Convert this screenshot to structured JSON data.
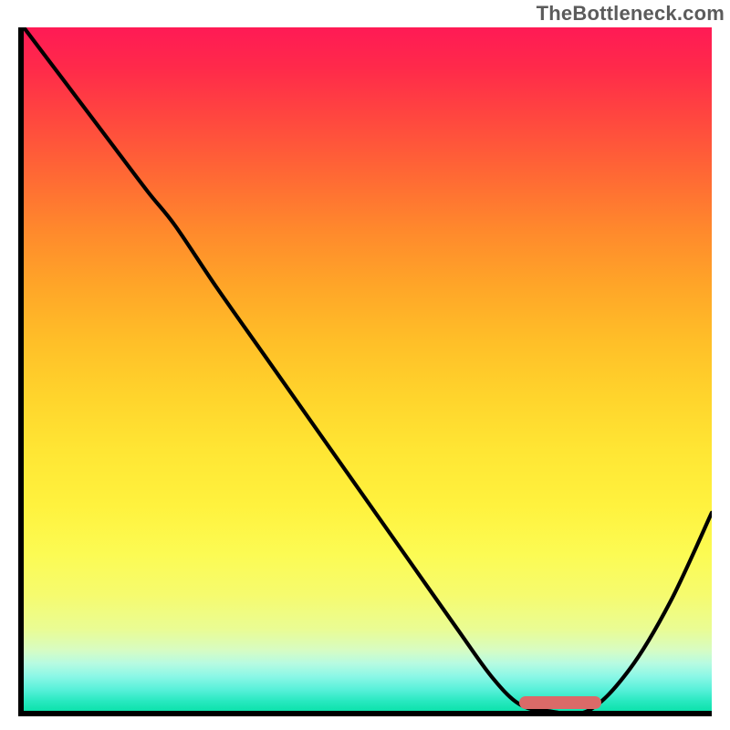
{
  "watermark": "TheBottleneck.com",
  "colors": {
    "axis": "#000000",
    "curve": "#000000",
    "marker": "#da6a68",
    "gradient_top": "#ff1a55",
    "gradient_bottom": "#0de2ac"
  },
  "chart_data": {
    "type": "line",
    "title": "",
    "xlabel": "",
    "ylabel": "",
    "xlim": [
      0,
      100
    ],
    "ylim": [
      0,
      100
    ],
    "grid": false,
    "background": "vertical-heatmap-gradient",
    "series": [
      {
        "name": "bottleneck-curve",
        "x": [
          0,
          6,
          12,
          18,
          22,
          28,
          35,
          42,
          49,
          56,
          63,
          68,
          72,
          76,
          82,
          88,
          94,
          100
        ],
        "y": [
          100,
          92,
          84,
          76,
          71,
          62,
          52,
          42,
          32,
          22,
          12,
          5,
          1,
          0,
          0,
          6,
          16,
          29
        ]
      }
    ],
    "annotations": [
      {
        "name": "optimal-range-marker",
        "x_start": 72,
        "x_end": 84,
        "y": 0,
        "color": "#da6a68"
      }
    ]
  }
}
